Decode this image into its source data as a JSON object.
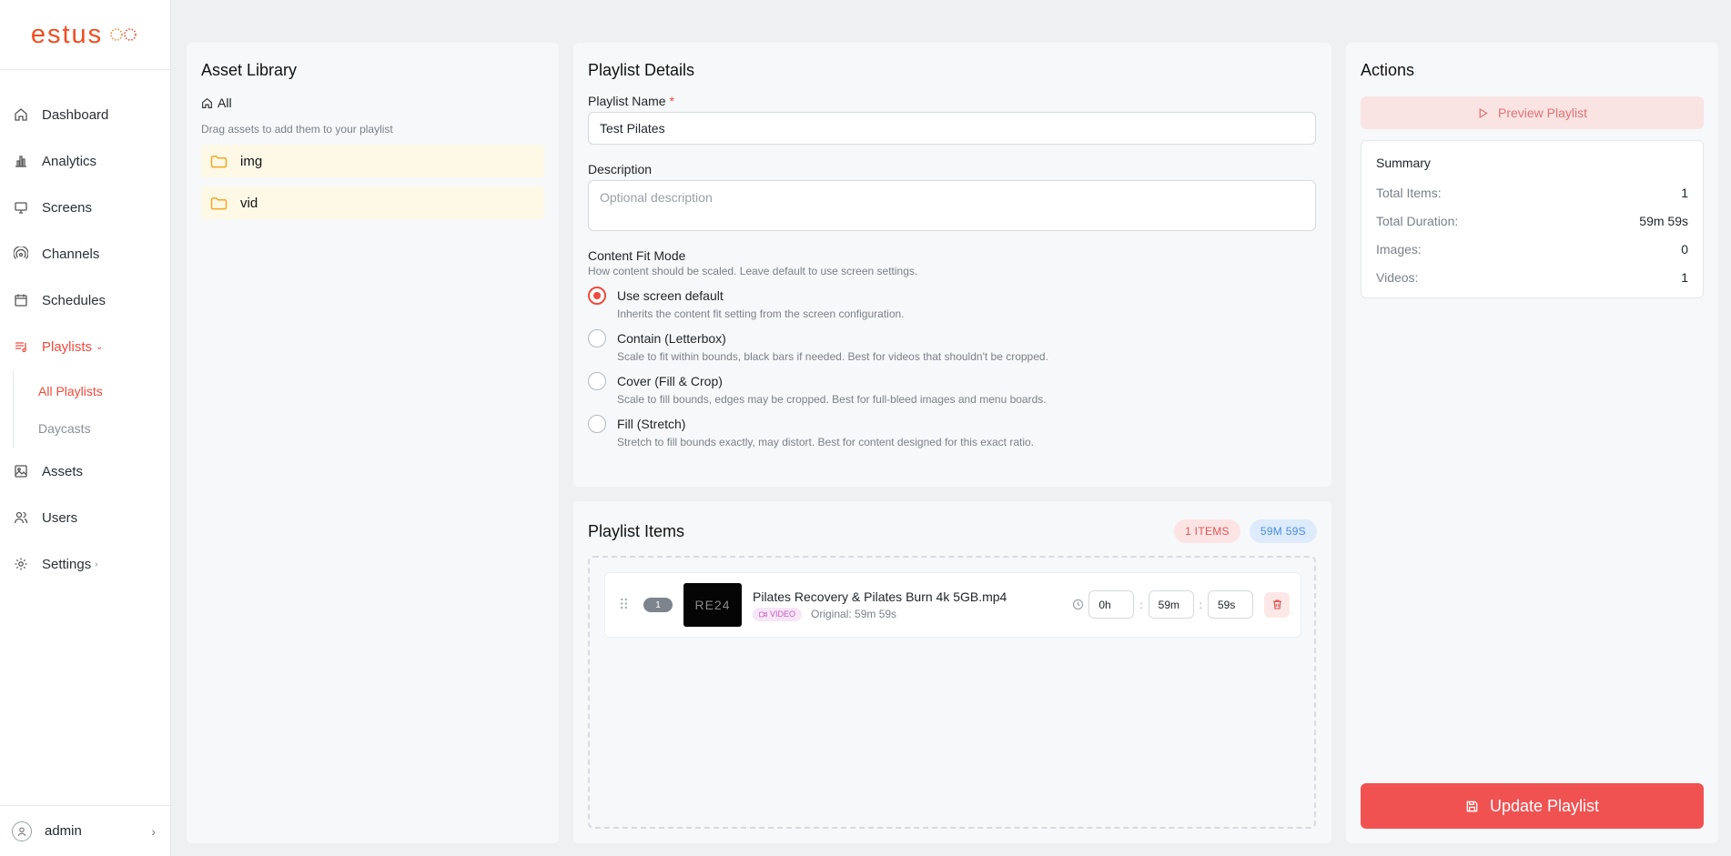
{
  "brand": {
    "logo_text": "estus",
    "accent": "#ef4a3c"
  },
  "sidebar": {
    "items": [
      {
        "label": "Dashboard",
        "icon": "home-icon"
      },
      {
        "label": "Analytics",
        "icon": "bar-chart-icon"
      },
      {
        "label": "Screens",
        "icon": "monitor-icon"
      },
      {
        "label": "Channels",
        "icon": "broadcast-icon"
      },
      {
        "label": "Schedules",
        "icon": "calendar-icon"
      },
      {
        "label": "Playlists",
        "icon": "playlist-icon"
      },
      {
        "label": "Assets",
        "icon": "image-icon"
      },
      {
        "label": "Users",
        "icon": "users-icon"
      },
      {
        "label": "Settings",
        "icon": "gear-icon"
      }
    ],
    "sub_items": [
      {
        "label": "All Playlists"
      },
      {
        "label": "Daycasts"
      }
    ],
    "user": {
      "name": "admin"
    }
  },
  "asset_library": {
    "title": "Asset Library",
    "breadcrumb": "All",
    "hint": "Drag assets to add them to your playlist",
    "folders": [
      {
        "name": "img"
      },
      {
        "name": "vid"
      }
    ]
  },
  "details": {
    "title": "Playlist Details",
    "name_label": "Playlist Name",
    "required_mark": "*",
    "name_value": "Test Pilates",
    "description_label": "Description",
    "description_placeholder": "Optional description",
    "fit_label": "Content Fit Mode",
    "fit_hint": "How content should be scaled. Leave default to use screen settings.",
    "fit_options": [
      {
        "title": "Use screen default",
        "desc": "Inherits the content fit setting from the screen configuration."
      },
      {
        "title": "Contain (Letterbox)",
        "desc": "Scale to fit within bounds, black bars if needed. Best for videos that shouldn't be cropped."
      },
      {
        "title": "Cover (Fill & Crop)",
        "desc": "Scale to fill bounds, edges may be cropped. Best for full-bleed images and menu boards."
      },
      {
        "title": "Fill (Stretch)",
        "desc": "Stretch to fill bounds exactly, may distort. Best for content designed for this exact ratio."
      }
    ],
    "fit_selected": 0
  },
  "items": {
    "title": "Playlist Items",
    "count_badge": "1 ITEMS",
    "duration_badge": "59M 59S",
    "list": [
      {
        "index": "1",
        "thumb_text": "RE24",
        "name": "Pilates Recovery & Pilates Burn 4k 5GB.mp4",
        "type": "VIDEO",
        "original": "Original: 59m 59s",
        "hours": "0h",
        "minutes": "59m",
        "seconds": "59s",
        "separator": ":"
      }
    ]
  },
  "actions": {
    "title": "Actions",
    "preview_label": "Preview Playlist",
    "summary_title": "Summary",
    "summary": [
      {
        "k": "Total Items:",
        "v": "1"
      },
      {
        "k": "Total Duration:",
        "v": "59m 59s"
      },
      {
        "k": "Images:",
        "v": "0"
      },
      {
        "k": "Videos:",
        "v": "1"
      }
    ],
    "update_label": "Update Playlist"
  }
}
